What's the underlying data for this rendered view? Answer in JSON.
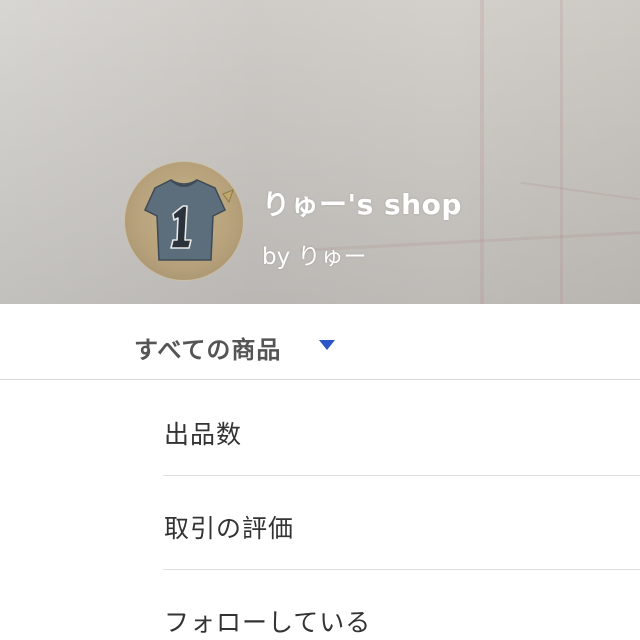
{
  "shop": {
    "name": "りゅー's shop",
    "owner": "by りゅー"
  },
  "filter": {
    "label": "すべての商品"
  },
  "menu": {
    "items": [
      {
        "label": "出品数"
      },
      {
        "label": "取引の評価"
      },
      {
        "label": "フォローしている"
      }
    ]
  },
  "colors": {
    "caret": "#2b56c8",
    "divider": "#dedede"
  }
}
